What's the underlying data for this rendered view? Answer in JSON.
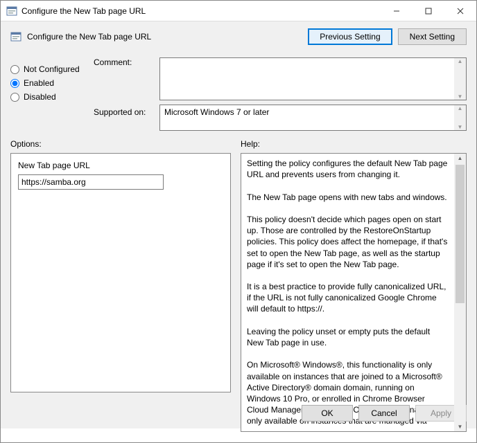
{
  "window": {
    "title": "Configure the New Tab page URL"
  },
  "toolbar": {
    "title": "Configure the New Tab page URL",
    "prev_label": "Previous Setting",
    "next_label": "Next Setting"
  },
  "state": {
    "not_configured_label": "Not Configured",
    "enabled_label": "Enabled",
    "disabled_label": "Disabled",
    "selected": "Enabled"
  },
  "labels": {
    "comment": "Comment:",
    "supported_on": "Supported on:",
    "options": "Options:",
    "help": "Help:"
  },
  "comment": {
    "value": ""
  },
  "supported_on": {
    "value": "Microsoft Windows 7 or later"
  },
  "options": {
    "field_label": "New Tab page URL",
    "field_value": "https://samba.org"
  },
  "help": {
    "text": "Setting the policy configures the default New Tab page URL and prevents users from changing it.\n\nThe New Tab page opens with new tabs and windows.\n\nThis policy doesn't decide which pages open on start up. Those are controlled by the RestoreOnStartup policies. This policy does affect the homepage, if that's set to open the New Tab page, as well as the startup page if it's set to open the New Tab page.\n\nIt is a best practice to provide fully canonicalized URL, if the URL is not fully canonicalized Google Chrome will default to https://.\n\nLeaving the policy unset or empty puts the default New Tab page in use.\n\nOn Microsoft® Windows®, this functionality is only available on instances that are joined to a Microsoft® Active Directory® domain domain, running on Windows 10 Pro, or enrolled in Chrome Browser Cloud Management. On macOS, this functionality is only available on instances that are managed via"
  },
  "footer": {
    "ok": "OK",
    "cancel": "Cancel",
    "apply": "Apply"
  }
}
